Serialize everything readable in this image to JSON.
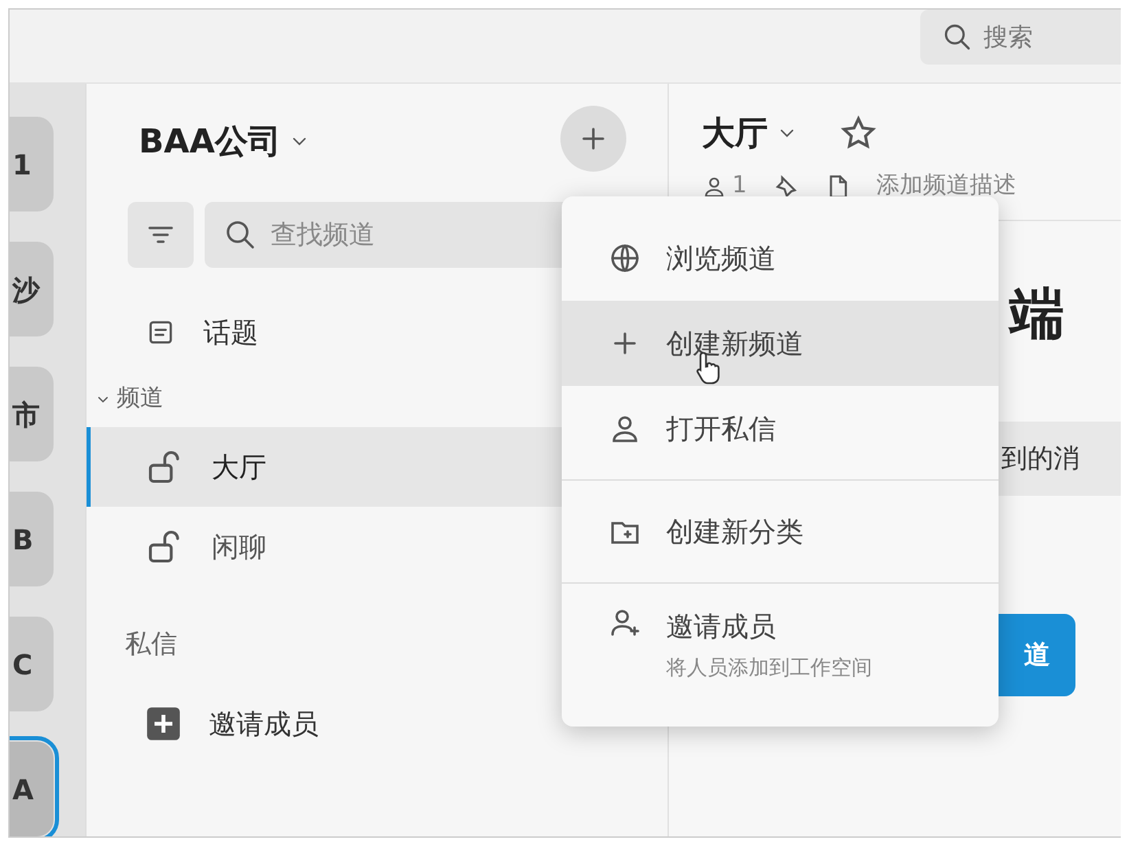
{
  "top_search": {
    "placeholder": "搜索"
  },
  "workspaces": [
    {
      "label": "1",
      "selected": false
    },
    {
      "label": "沙",
      "selected": false
    },
    {
      "label": "市",
      "selected": false
    },
    {
      "label": "B",
      "selected": false
    },
    {
      "label": "C",
      "selected": false
    },
    {
      "label": "A",
      "selected": true
    }
  ],
  "sidebar": {
    "workspace_name": "BAA公司",
    "search": {
      "placeholder": "查找频道"
    },
    "topics": "话题",
    "channels_header": "频道",
    "channels_expanded": true,
    "channels": [
      {
        "name": "大厅",
        "selected": true
      },
      {
        "name": "闲聊",
        "selected": false
      }
    ],
    "dm_header": "私信",
    "invite": "邀请成员"
  },
  "channel": {
    "title": "大厅",
    "starred": false,
    "member_count": "1",
    "description_placeholder": "添加频道描述",
    "heading": "端",
    "banner_text": "到的消",
    "button": "道"
  },
  "menu": {
    "items": [
      {
        "kind": "browse",
        "label": "浏览频道",
        "hovered": false
      },
      {
        "kind": "create",
        "label": "创建新频道",
        "hovered": true
      },
      {
        "kind": "dm",
        "label": "打开私信",
        "hovered": false
      },
      {
        "kind": "folder",
        "label": "创建新分类",
        "hovered": false
      },
      {
        "kind": "invite",
        "label": "邀请成员",
        "subtitle": "将人员添加到工作空间",
        "hovered": false
      }
    ]
  }
}
